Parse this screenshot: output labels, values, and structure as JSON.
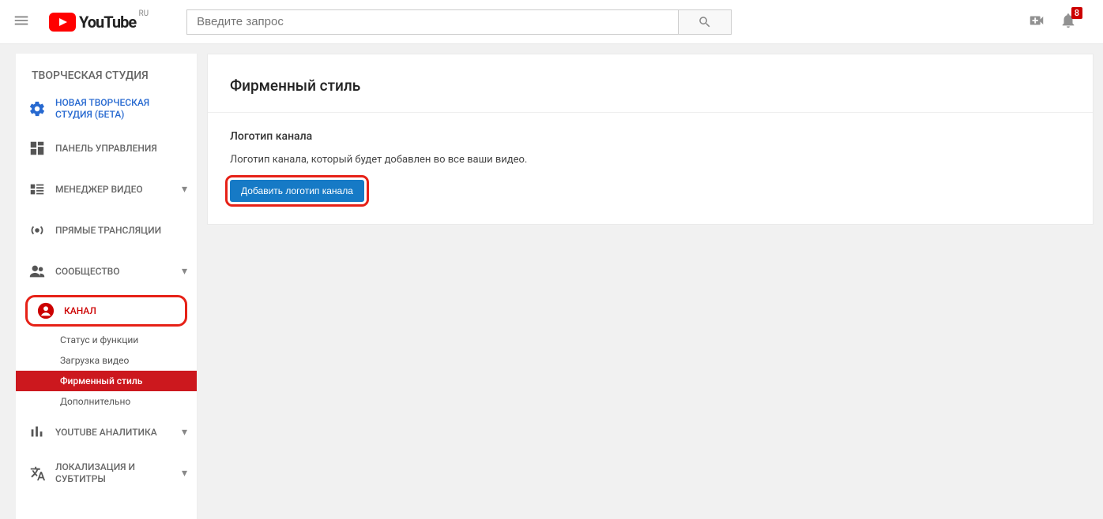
{
  "header": {
    "logo_country": "RU",
    "search_placeholder": "Введите запрос",
    "notification_count": "8"
  },
  "sidebar": {
    "title": "ТВОРЧЕСКАЯ СТУДИЯ",
    "items": {
      "beta": {
        "label": "НОВАЯ ТВОРЧЕСКАЯ СТУДИЯ (БЕТА)"
      },
      "dashboard": {
        "label": "ПАНЕЛЬ УПРАВЛЕНИЯ"
      },
      "video_mgr": {
        "label": "МЕНЕДЖЕР ВИДЕО"
      },
      "live": {
        "label": "ПРЯМЫЕ ТРАНСЛЯЦИИ"
      },
      "community": {
        "label": "СООБЩЕСТВО"
      },
      "channel": {
        "label": "КАНАЛ"
      },
      "analytics": {
        "label": "YOUTUBE АНАЛИТИКА"
      },
      "localization": {
        "label": "ЛОКАЛИЗАЦИЯ И СУБТИТРЫ"
      }
    },
    "channel_subitems": {
      "status": {
        "label": "Статус и функции"
      },
      "upload": {
        "label": "Загрузка видео"
      },
      "branding": {
        "label": "Фирменный стиль"
      },
      "advanced": {
        "label": "Дополнительно"
      }
    }
  },
  "main": {
    "page_title": "Фирменный стиль",
    "section": {
      "heading": "Логотип канала",
      "description": "Логотип канала, который будет добавлен во все ваши видео.",
      "button_label": "Добавить логотип канала"
    }
  },
  "colors": {
    "youtube_red": "#cc181e",
    "link_blue": "#167ac6"
  }
}
